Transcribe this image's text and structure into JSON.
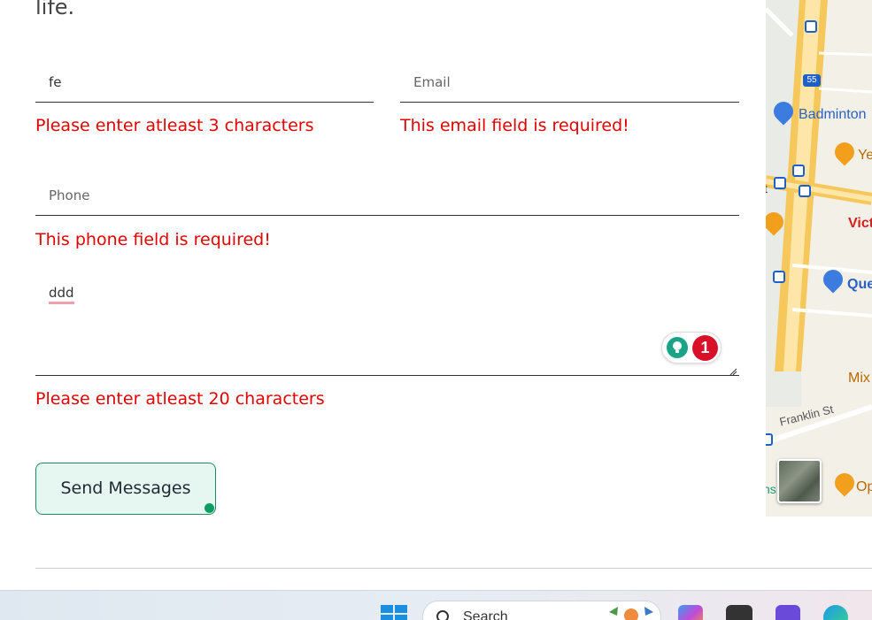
{
  "intro": {
    "text": "life."
  },
  "form": {
    "name": {
      "value": "fe",
      "error": "Please enter atleast 3 characters"
    },
    "email": {
      "placeholder": "Email",
      "error": "This email field is required!"
    },
    "phone": {
      "placeholder": "Phone",
      "error": "This phone field is required!"
    },
    "message": {
      "value": "ddd",
      "error": "Please enter atleast 20 characters",
      "grammar_issue_count": "1"
    },
    "submit_label": "Send Messages"
  },
  "map": {
    "labels": [
      "Badminton",
      "Ye",
      "Vict",
      "Que",
      "Mix",
      "Franklin St",
      "Op",
      "t",
      "ns"
    ],
    "route_badge": "55"
  },
  "taskbar": {
    "search_label": "Search"
  },
  "colors": {
    "error": "#e00000",
    "accent": "#1c8a62",
    "button_bg": "#e6f6f0"
  }
}
